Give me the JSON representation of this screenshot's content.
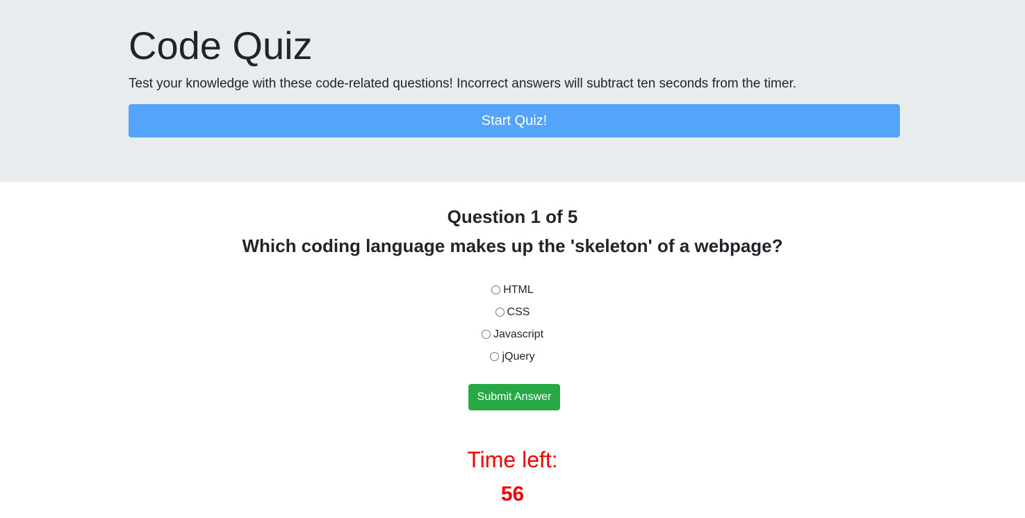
{
  "header": {
    "title": "Code Quiz",
    "lead": "Test your knowledge with these code-related questions! Incorrect answers will subtract ten seconds from the timer.",
    "start_label": "Start Quiz!"
  },
  "quiz": {
    "counter": "Question 1 of 5",
    "question": "Which coding language makes up the 'skeleton' of a webpage?",
    "options": [
      "HTML",
      "CSS",
      "Javascript",
      "jQuery"
    ],
    "submit_label": "Submit Answer"
  },
  "timer": {
    "label": "Time left:",
    "value": "56"
  },
  "colors": {
    "jumbotron_bg": "#e9ecef",
    "start_button": "#54a4fb",
    "submit_button": "#28a745",
    "timer_text": "#ee0000"
  }
}
